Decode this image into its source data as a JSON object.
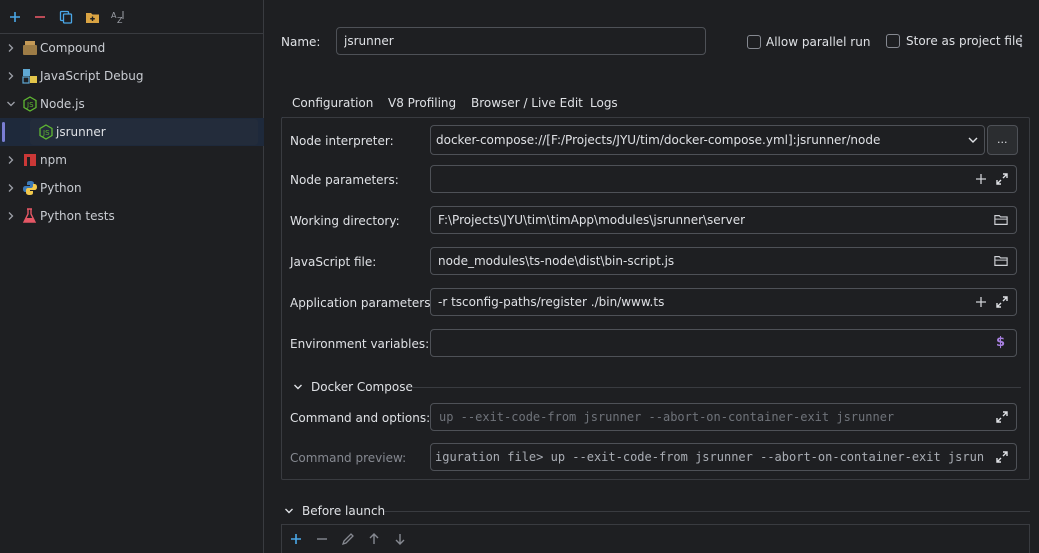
{
  "sidebar": {
    "toolbar": {
      "add_icon": "plus-icon",
      "remove_icon": "minus-icon",
      "copy_icon": "copy-icon",
      "folder_icon": "new-folder-icon",
      "sort_icon": "sort-alpha-icon"
    },
    "items": [
      {
        "label": "Compound",
        "icon": "compound-icon",
        "expanded": false
      },
      {
        "label": "JavaScript Debug",
        "icon": "js-debug-icon",
        "expanded": false
      },
      {
        "label": "Node.js",
        "icon": "nodejs-icon",
        "expanded": true
      },
      {
        "label": "jsrunner",
        "icon": "nodejs-icon",
        "selected": true
      },
      {
        "label": "npm",
        "icon": "npm-icon",
        "expanded": false
      },
      {
        "label": "Python",
        "icon": "python-icon",
        "expanded": false
      },
      {
        "label": "Python tests",
        "icon": "python-tests-icon",
        "expanded": false
      }
    ]
  },
  "header": {
    "name_label": "Name:",
    "name_value": "jsrunner",
    "allow_parallel": "Allow parallel run",
    "store_as_file": "Store as project file"
  },
  "tabs": [
    "Configuration",
    "V8 Profiling",
    "Browser / Live Edit",
    "Logs"
  ],
  "form": {
    "node_interpreter_label": "Node interpreter:",
    "node_interpreter_value": "docker-compose://[F:/Projects/JYU/tim/docker-compose.yml]:jsrunner/node",
    "node_interpreter_more": "...",
    "node_parameters_label": "Node parameters:",
    "node_parameters_value": "",
    "working_dir_label": "Working directory:",
    "working_dir_value": "F:\\Projects\\JYU\\tim\\timApp\\modules\\jsrunner\\server",
    "js_file_label": "JavaScript file:",
    "js_file_value": "node_modules\\ts-node\\dist\\bin-script.js",
    "app_params_label": "Application parameters:",
    "app_params_value": "-r tsconfig-paths/register ./bin/www.ts",
    "env_vars_label": "Environment variables:",
    "env_vars_value": "",
    "env_vars_icon": "$"
  },
  "docker": {
    "section_title": "Docker Compose",
    "command_label": "Command and options:",
    "command_placeholder": "up --exit-code-from jsrunner --abort-on-container-exit jsrunner",
    "preview_label": "Command preview:",
    "preview_value": "iguration file> up --exit-code-from jsrunner --abort-on-container-exit jsrunner"
  },
  "before_launch": {
    "section_title": "Before launch"
  },
  "colors": {
    "accent": "#3574f0",
    "background": "#1e1f22",
    "border": "#4e5157",
    "node_green": "#5fb832"
  }
}
